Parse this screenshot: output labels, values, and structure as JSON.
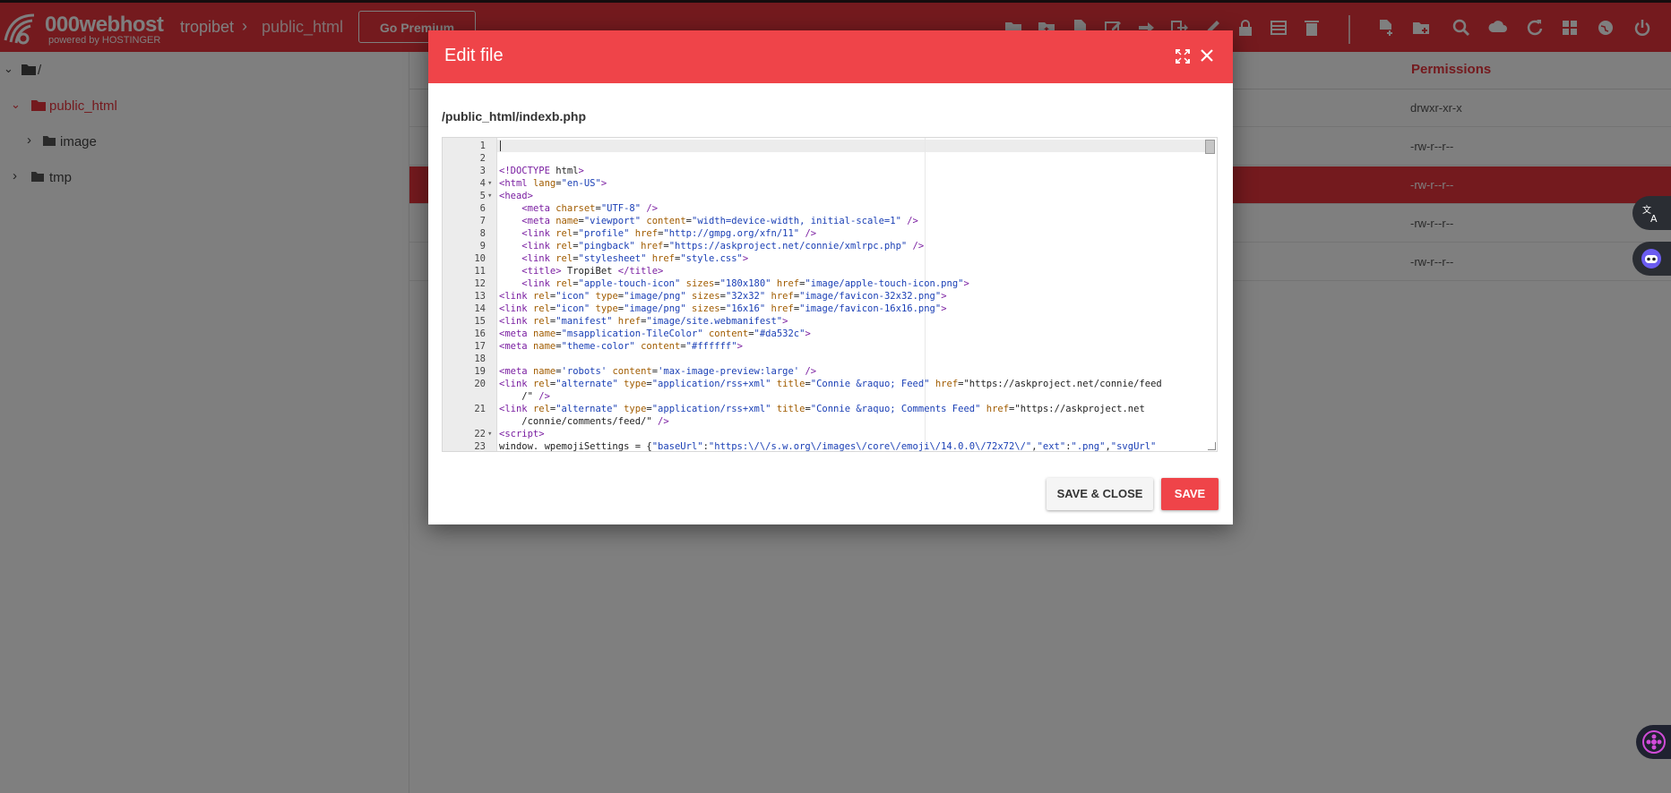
{
  "header": {
    "brand": "000webhost",
    "brand_sub": "powered by HOSTINGER",
    "breadcrumb": [
      "tropibet",
      "public_html"
    ],
    "premium_button": "Go Premium"
  },
  "toolbar_icons": [
    "folder-open-icon",
    "folder-upload-icon",
    "new-file-icon",
    "edit-file-icon",
    "move-icon",
    "export-icon",
    "rename-icon",
    "lock-icon",
    "archive-icon",
    "trash-icon",
    "new-file-plus-icon",
    "new-folder-icon",
    "search-icon",
    "upload-icon",
    "refresh-icon",
    "grid-icon",
    "globe-icon",
    "power-icon"
  ],
  "tree": [
    {
      "label": "/",
      "expanded": true
    },
    {
      "label": "public_html",
      "expanded": true,
      "active": true
    },
    {
      "label": "image",
      "expanded": false
    },
    {
      "label": "tmp",
      "expanded": false
    }
  ],
  "table": {
    "permissions_header": "Permissions",
    "rows": [
      {
        "permissions": "drwxr-xr-x",
        "selected": false
      },
      {
        "permissions": "-rw-r--r--",
        "selected": false
      },
      {
        "permissions": "-rw-r--r--",
        "selected": true
      },
      {
        "permissions": "-rw-r--r--",
        "selected": false
      },
      {
        "permissions": "-rw-r--r--",
        "selected": false
      }
    ]
  },
  "modal": {
    "title": "Edit file",
    "path": "/public_html/indexb.php",
    "save_close": "SAVE & CLOSE",
    "save": "SAVE"
  },
  "code": [
    {
      "n": "1",
      "f": "",
      "t": ""
    },
    {
      "n": "2",
      "f": "",
      "t": ""
    },
    {
      "n": "3",
      "f": "",
      "t": "<!DOCTYPE html>"
    },
    {
      "n": "4",
      "f": "▾",
      "t": "<html lang=\"en-US\">"
    },
    {
      "n": "5",
      "f": "▾",
      "t": "<head>"
    },
    {
      "n": "6",
      "f": "",
      "t": "    <meta charset=\"UTF-8\" />"
    },
    {
      "n": "7",
      "f": "",
      "t": "    <meta name=\"viewport\" content=\"width=device-width, initial-scale=1\" />"
    },
    {
      "n": "8",
      "f": "",
      "t": "    <link rel=\"profile\" href=\"http://gmpg.org/xfn/11\" />"
    },
    {
      "n": "9",
      "f": "",
      "t": "    <link rel=\"pingback\" href=\"https://askproject.net/connie/xmlrpc.php\" />"
    },
    {
      "n": "10",
      "f": "",
      "t": "    <link rel=\"stylesheet\" href=\"style.css\">"
    },
    {
      "n": "11",
      "f": "",
      "t": "    <title> TropiBet </title>"
    },
    {
      "n": "12",
      "f": "",
      "t": "    <link rel=\"apple-touch-icon\" sizes=\"180x180\" href=\"image/apple-touch-icon.png\">"
    },
    {
      "n": "13",
      "f": "",
      "t": "<link rel=\"icon\" type=\"image/png\" sizes=\"32x32\" href=\"image/favicon-32x32.png\">"
    },
    {
      "n": "14",
      "f": "",
      "t": "<link rel=\"icon\" type=\"image/png\" sizes=\"16x16\" href=\"image/favicon-16x16.png\">"
    },
    {
      "n": "15",
      "f": "",
      "t": "<link rel=\"manifest\" href=\"image/site.webmanifest\">"
    },
    {
      "n": "16",
      "f": "",
      "t": "<meta name=\"msapplication-TileColor\" content=\"#da532c\">"
    },
    {
      "n": "17",
      "f": "",
      "t": "<meta name=\"theme-color\" content=\"#ffffff\">"
    },
    {
      "n": "18",
      "f": "",
      "t": ""
    },
    {
      "n": "19",
      "f": "",
      "t": "<meta name='robots' content='max-image-preview:large' />"
    },
    {
      "n": "20",
      "f": "",
      "t": "<link rel=\"alternate\" type=\"application/rss+xml\" title=\"Connie &raquo; Feed\" href=\"https://askproject.net/connie/feed"
    },
    {
      "n": "",
      "f": "",
      "t": "    /\" />"
    },
    {
      "n": "21",
      "f": "",
      "t": "<link rel=\"alternate\" type=\"application/rss+xml\" title=\"Connie &raquo; Comments Feed\" href=\"https://askproject.net"
    },
    {
      "n": "",
      "f": "",
      "t": "    /connie/comments/feed/\" />"
    },
    {
      "n": "22",
      "f": "▾",
      "t": "<script>"
    },
    {
      "n": "23",
      "f": "",
      "t": "window._wpemojiSettings = {\"baseUrl\":\"https:\\/\\/s.w.org\\/images\\/core\\/emoji\\/14.0.0\\/72x72\\/\",\"ext\":\".png\",\"svgUrl\""
    }
  ],
  "colors": {
    "brand_red": "#e8353d",
    "header_red": "#ef4449",
    "overlay": "rgba(0,0,0,0.5)"
  }
}
